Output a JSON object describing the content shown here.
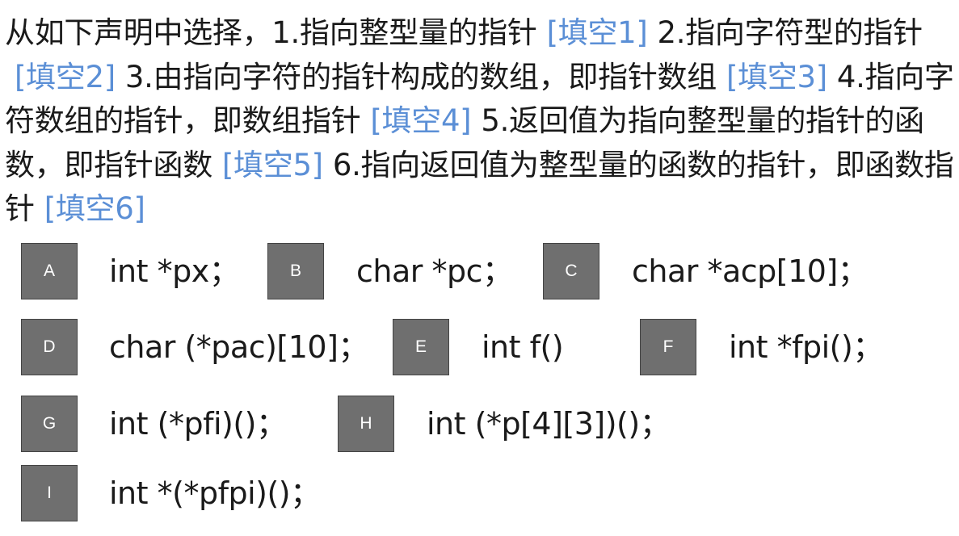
{
  "question": {
    "segments": [
      {
        "type": "text",
        "value": "从如下声明中选择，1.指向整型量的指针"
      },
      {
        "type": "blank",
        "value": "[填空1]"
      },
      {
        "type": "text",
        "value": "2.指向字符型的指针"
      },
      {
        "type": "blank",
        "value": "[填空2]"
      },
      {
        "type": "text",
        "value": "3.由指向字符的指针构成的数组，即指针数组"
      },
      {
        "type": "blank",
        "value": "[填空3]"
      },
      {
        "type": "text",
        "value": "4.指向字符数组的指针，即数组指针"
      },
      {
        "type": "blank",
        "value": "[填空4]"
      },
      {
        "type": "text",
        "value": "5.返回值为指向整型量的指针的函数，即指针函数"
      },
      {
        "type": "blank",
        "value": "[填空5]"
      },
      {
        "type": "text",
        "value": "6.指向返回值为整型量的函数的指针，即函数指针"
      },
      {
        "type": "blank",
        "value": "[填空6]"
      }
    ]
  },
  "options": [
    {
      "letter": "A",
      "code": "int *px；"
    },
    {
      "letter": "B",
      "code": "char *pc；"
    },
    {
      "letter": "C",
      "code": "char *acp[10]；"
    },
    {
      "letter": "D",
      "code": "char (*pac)[10]；"
    },
    {
      "letter": "E",
      "code": "int f()"
    },
    {
      "letter": "F",
      "code": "int *fpi()；"
    },
    {
      "letter": "G",
      "code": "int (*pfi)()；"
    },
    {
      "letter": "H",
      "code": "int (*p[4][3])()；"
    },
    {
      "letter": "I",
      "code": "int *(*pfpi)()；"
    }
  ],
  "colors": {
    "blank": "#5b8fd6",
    "badge_bg": "#6f6f6f",
    "text": "#1a1a1a"
  }
}
